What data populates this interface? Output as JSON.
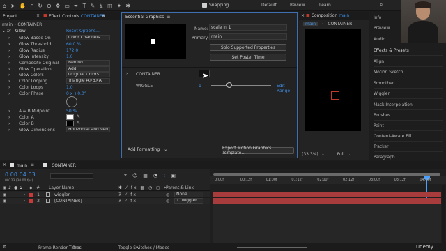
{
  "topbar": {
    "workspaces": [
      "Default",
      "Review",
      "Learn"
    ],
    "snapping_label": "Snapping"
  },
  "project_panel": {
    "tab": "Project"
  },
  "effect_controls": {
    "tab_label": "Effect Controls",
    "tab_layer": "CONTAINER",
    "context": "main • CONTAINER",
    "effect_name": "Glow",
    "reset": "Reset",
    "options": "Options...",
    "params": [
      {
        "label": "Glow Based On",
        "value": "Color Channels",
        "kind": "dd"
      },
      {
        "label": "Glow Threshold",
        "value": "60.0 %",
        "kind": "num"
      },
      {
        "label": "Glow Radius",
        "value": "172.0",
        "kind": "num"
      },
      {
        "label": "Glow Intensity",
        "value": "1.0",
        "kind": "num"
      },
      {
        "label": "Composite Original",
        "value": "Behind",
        "kind": "dd"
      },
      {
        "label": "Glow Operation",
        "value": "Add",
        "kind": "dd"
      },
      {
        "label": "Glow Colors",
        "value": "Original Colors",
        "kind": "dd"
      },
      {
        "label": "Color Looping",
        "value": "Triangle A>B>A",
        "kind": "dd"
      },
      {
        "label": "Color Loops",
        "value": "1.0",
        "kind": "num"
      },
      {
        "label": "Color Phase",
        "value": "0 x +0.0°",
        "kind": "num"
      }
    ],
    "params2": [
      {
        "label": "A & B Midpoint",
        "value": "50 %",
        "kind": "num"
      },
      {
        "label": "Color A",
        "value": "",
        "kind": "color"
      },
      {
        "label": "Color B",
        "value": "",
        "kind": "color"
      },
      {
        "label": "Glow Dimensions",
        "value": "Horizontal and Vertica",
        "kind": "dd"
      }
    ]
  },
  "essential_graphics": {
    "title": "Essential Graphics",
    "name_label": "Name:",
    "name_value": "scale in 1",
    "primary_label": "Primary:",
    "primary_value": "main",
    "solo_button": "Solo Supported Properties",
    "poster_button": "Set Poster Time",
    "container_label": "CONTAINER",
    "wiggle_label": "WIGGLE",
    "wiggle_value": "1",
    "edit_range": "Edit Range",
    "add_formatting": "Add Formatting",
    "export_button": "Export Motion Graphics Template..."
  },
  "composition": {
    "tab_label": "Composition",
    "tab_comp": "main",
    "crumb1": "main",
    "crumb2": "CONTAINER",
    "zoom": "(33.3%)",
    "resolution": "Full"
  },
  "right_panel": {
    "items": [
      "Info",
      "Preview",
      "Audio",
      "Effects & Presets",
      "Align",
      "Motion Sketch",
      "Smoother",
      "Wiggler",
      "Mask Interpolation",
      "Brushes",
      "Paint",
      "Content-Aware Fill",
      "Tracker",
      "Paragraph"
    ]
  },
  "timeline": {
    "tab_main": "main",
    "tab_container": "CONTAINER",
    "timecode": "0:00:04:03",
    "frames": "00123 (30.00 fps)",
    "col_layer_name": "Layer Name",
    "col_parent": "Parent & Link",
    "layers": [
      {
        "num": "1",
        "name": "wiggler",
        "parent": "None",
        "color": "#c83a3a"
      },
      {
        "num": "2",
        "name": "[CONTAINER]",
        "parent": "1. wiggler",
        "color": "#c83a3a"
      }
    ],
    "ruler_ticks": [
      "0:00f",
      "00:12f",
      "01:00f",
      "01:12f",
      "02:00f",
      "02:12f",
      "03:00f",
      "03:12f",
      "04:00f"
    ],
    "frame_render_label": "Frame Render Time:",
    "frame_render_value": "0ms",
    "toggle_label": "Toggle Switches / Modes"
  },
  "watermark": "Udemy",
  "colors": {
    "accent_blue": "#3e8fe6",
    "layer_red": "#c83a3a",
    "bar_red": "#a83b3b",
    "playhead": "#4aa0ff"
  }
}
